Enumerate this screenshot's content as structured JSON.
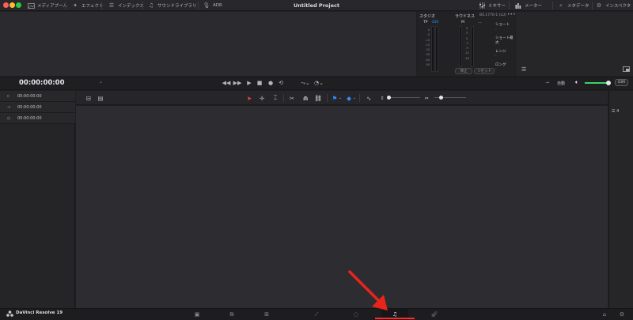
{
  "toolbar": {
    "media_pool": "メディアプール",
    "effects": "エフェクト",
    "index": "インデックス",
    "sound_library": "サウンドライブラリ",
    "adr": "ADR",
    "project_title": "Untitled Project",
    "mixer": "ミキサー",
    "meters": "メーター",
    "metadata": "メタデータ",
    "inspector": "インスペクタ"
  },
  "meters_panel": {
    "studio_label": "スタジオ",
    "tp_label": "TP",
    "tp_value": "-100",
    "loudness_label": "ラウドネス",
    "standard": "BS.1770-1 (LU)",
    "m_label": "M",
    "short_label": "ショート",
    "short_value": "-",
    "short_max_label": "ショート最大",
    "short_max_value": "-",
    "range_label": "レンジ",
    "range_value": "-",
    "long_label": "ロング",
    "long_value": "-",
    "pause_button": "停止",
    "reset_button": "リセット",
    "studio_scale": [
      "0",
      "-5",
      "-10",
      "-15",
      "-20",
      "-30",
      "-40",
      "-50"
    ],
    "loud_scale": [
      "9",
      "3",
      "0",
      "-3",
      "-9",
      "-12",
      "-18"
    ]
  },
  "transport": {
    "timecode": "00:00:00:00",
    "auto_label": "自動",
    "dim_label": "DIM",
    "volume_level": 0.9
  },
  "tracks": [
    {
      "icon": "mark-in-icon",
      "timecode": "00:00:00:00"
    },
    {
      "icon": "mark-out-icon",
      "timecode": "00:00:00:00"
    },
    {
      "icon": "duration-icon",
      "timecode": "00:00:00:00"
    }
  ],
  "footer": {
    "app_name": "DaVinci Resolve 19",
    "active_page": "fairlight"
  },
  "colors": {
    "accent_blue": "#2f8fff",
    "active_red": "#ff2a2a",
    "volume_green": "#3bd26a"
  }
}
